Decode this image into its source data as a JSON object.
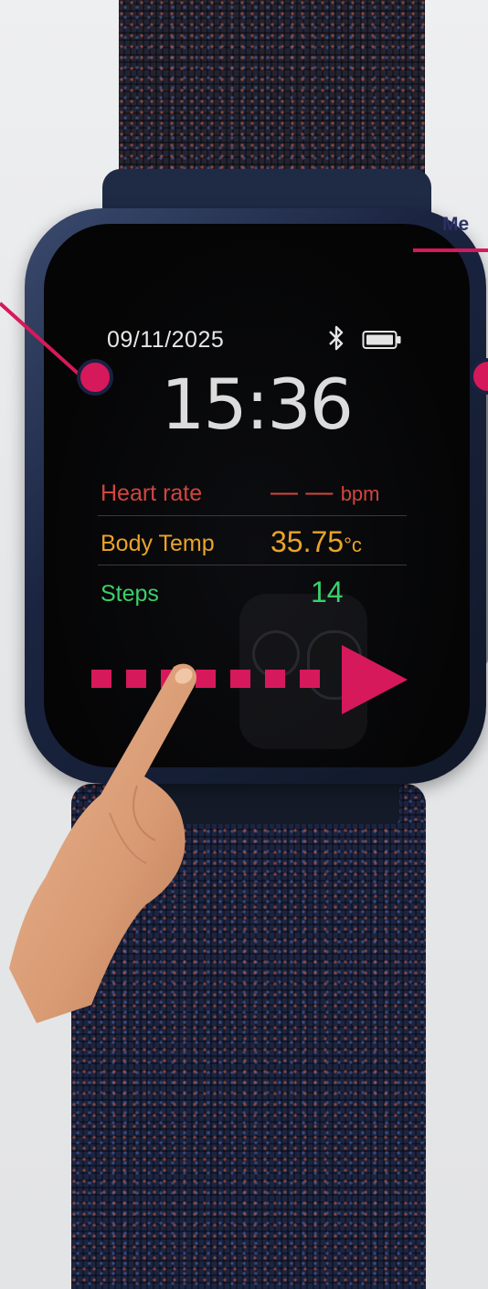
{
  "screen": {
    "date": "09/11/2025",
    "time": "15:36",
    "status_icons": [
      "bluetooth-icon",
      "battery-icon"
    ],
    "metrics": [
      {
        "label": "Heart rate",
        "value": "— —",
        "unit": "bpm",
        "color": "#d1463e"
      },
      {
        "label": "Body Temp",
        "value": "35.75",
        "unit": "°c",
        "color": "#eaa42a"
      },
      {
        "label": "Steps",
        "value": "14",
        "unit": "",
        "color": "#3ccf6a"
      }
    ]
  },
  "annotation": {
    "callout_label": "Me",
    "accent_color": "#d6195a",
    "gesture": "swipe-right"
  }
}
